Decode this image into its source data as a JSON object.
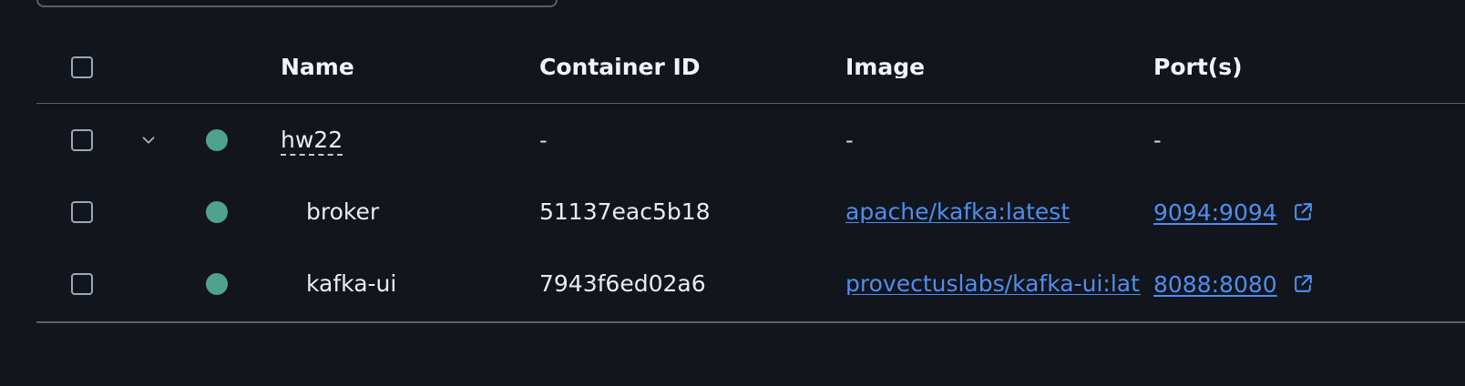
{
  "table": {
    "headers": {
      "name": "Name",
      "container_id": "Container ID",
      "image": "Image",
      "ports": "Port(s)"
    },
    "group": {
      "name": "hw22",
      "container_id": "-",
      "image": "-",
      "ports": "-",
      "status_color": "#4fa38c"
    },
    "containers": [
      {
        "name": "broker",
        "container_id": "51137eac5b18",
        "image": "apache/kafka:latest",
        "ports": "9094:9094",
        "status_color": "#4fa38c"
      },
      {
        "name": "kafka-ui",
        "container_id": "7943f6ed02a6",
        "image": "provectuslabs/kafka-ui:latest",
        "ports": "8088:8080",
        "status_color": "#4fa38c"
      }
    ]
  },
  "icons": {
    "chevron": "chevron-down-icon",
    "external": "external-link-icon",
    "status": "running-status-icon"
  },
  "colors": {
    "background": "#12151b",
    "link": "#4f8df1",
    "running": "#4fa38c",
    "border": "#59636f"
  }
}
